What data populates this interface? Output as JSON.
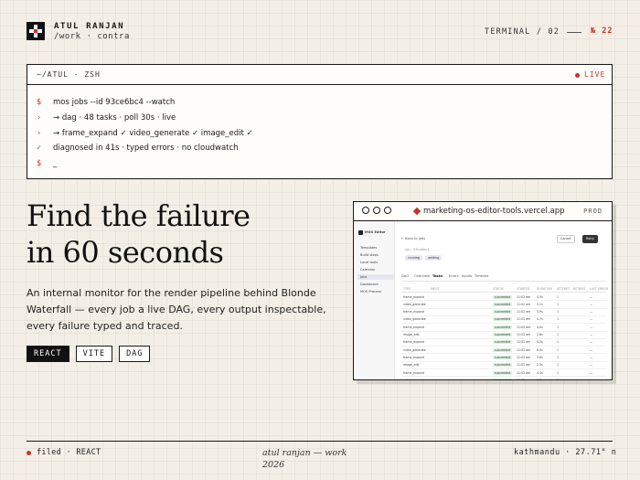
{
  "header": {
    "name": "ATUL RANJAN",
    "subtitle": "/work · contra",
    "terminal_label": "TERMINAL / 02",
    "count": "№ 22"
  },
  "terminal": {
    "title": "~/ATUL · ZSH",
    "live": "LIVE",
    "lines": [
      {
        "prefix": "$",
        "text": "mos jobs --id 93ce6bc4 --watch"
      },
      {
        "prefix": "›",
        "text": "→ dag · 48 tasks · poll 30s · live"
      },
      {
        "prefix": "›",
        "text": "→ frame_expand ✓ video_generate ✓ image_edit ✓"
      },
      {
        "prefix": "✓",
        "text": "diagnosed in 41s · typed errors · no cloudwatch"
      },
      {
        "prefix": "$",
        "text": "_"
      }
    ]
  },
  "hero": {
    "title_line1": "Find the failure",
    "title_line2": "in 60 seconds",
    "description": "An internal monitor for the render pipeline behind Blonde Waterfall — every job a live DAG, every output inspectable, every failure typed and traced.",
    "tags": [
      "REACT",
      "VITE",
      "DAG"
    ]
  },
  "preview": {
    "url": "marketing-os-editor-tools.vercel.app",
    "env": "PROD",
    "app_name": "MOS Editor",
    "sidebar": [
      "Templates",
      "Build steps",
      "Local tools",
      "Calendar",
      "Jobs",
      "Dashboard",
      "MOS Process"
    ],
    "back": "← Back to jobs",
    "actions": [
      "Cancel",
      "Retry"
    ],
    "status_chips": [
      "running",
      "waiting"
    ],
    "tabs": [
      "DAG",
      "Overview",
      "Tasks",
      "Errors",
      "Inputs",
      "Timeline"
    ],
    "columns": [
      "TYPE",
      "INPUT",
      "STATUS",
      "STARTED",
      "DURATION",
      "ATTEMPT",
      "RETRIES",
      "LAST ERROR"
    ],
    "rows": [
      {
        "type": "frame_expand",
        "input": "",
        "status": "succeeded",
        "started": "11:02 am",
        "duration": "4.3s",
        "attempt": "1"
      },
      {
        "type": "video_generate",
        "input": "",
        "status": "succeeded",
        "started": "11:02 am",
        "duration": "5.1s",
        "attempt": "1"
      },
      {
        "type": "frame_expand",
        "input": "",
        "status": "succeeded",
        "started": "11:02 am",
        "duration": "3.9s",
        "attempt": "1"
      },
      {
        "type": "video_generate",
        "input": "",
        "status": "succeeded",
        "started": "11:02 am",
        "duration": "4.7s",
        "attempt": "1"
      },
      {
        "type": "frame_expand",
        "input": "",
        "status": "succeeded",
        "started": "11:02 am",
        "duration": "4.0s",
        "attempt": "1"
      },
      {
        "type": "image_edit",
        "input": "",
        "status": "succeeded",
        "started": "11:02 am",
        "duration": "2.8s",
        "attempt": "1"
      },
      {
        "type": "frame_expand",
        "input": "",
        "status": "succeeded",
        "started": "11:02 am",
        "duration": "4.2s",
        "attempt": "1"
      },
      {
        "type": "video_generate",
        "input": "",
        "status": "succeeded",
        "started": "11:02 am",
        "duration": "6.0s",
        "attempt": "1"
      },
      {
        "type": "frame_expand",
        "input": "",
        "status": "succeeded",
        "started": "11:02 am",
        "duration": "3.6s",
        "attempt": "1"
      },
      {
        "type": "image_edit",
        "input": "",
        "status": "succeeded",
        "started": "11:02 am",
        "duration": "2.5s",
        "attempt": "1"
      },
      {
        "type": "frame_expand",
        "input": "",
        "status": "succeeded",
        "started": "11:02 am",
        "duration": "4.4s",
        "attempt": "1"
      },
      {
        "type": "video_generate",
        "input": "",
        "status": "succeeded",
        "started": "11:02 am",
        "duration": "5.3s",
        "attempt": "1"
      }
    ]
  },
  "footer": {
    "filed": "filed · REACT",
    "center_line1": "atul ranjan — work",
    "center_line2": "2026",
    "location": "kathmandu · 27.71° n"
  },
  "colors": {
    "background": "#f4efe6",
    "accent": "#c8322a",
    "ink": "#1a1a1a",
    "success": "#2f7a44"
  }
}
